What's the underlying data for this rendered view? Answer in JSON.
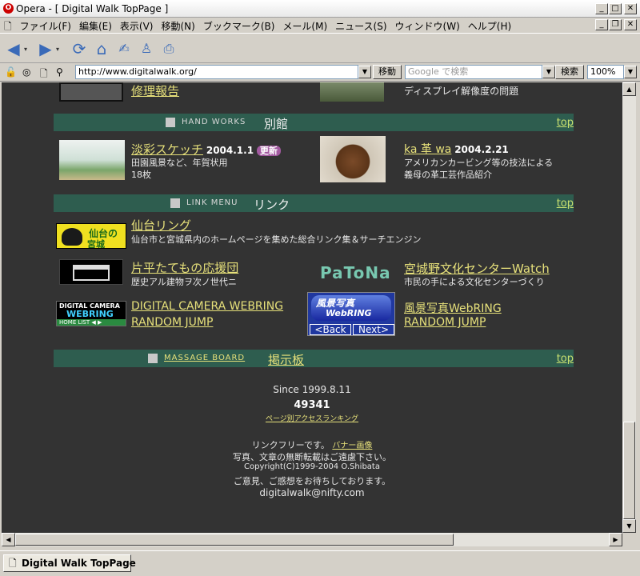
{
  "window": {
    "title": "Opera - [ Digital Walk TopPage ]"
  },
  "menu": [
    "ファイル(F)",
    "編集(E)",
    "表示(V)",
    "移動(N)",
    "ブックマーク(B)",
    "メール(M)",
    "ニュース(S)",
    "ウィンドウ(W)",
    "ヘルプ(H)"
  ],
  "address": {
    "url": "http://www.digitalwalk.org/",
    "go_label": "移動",
    "search_placeholder": "Google で検索",
    "search_label": "検索",
    "zoom": "100%"
  },
  "content": {
    "top_row": {
      "left_link": "修理報告",
      "right_desc": "ディスプレイ解像度の問題"
    },
    "handworks": {
      "en": "HAND WORKS",
      "jp": "別館",
      "top": "top",
      "items": [
        {
          "title": "淡彩スケッチ",
          "date": "2004.1.1",
          "badge": "更新",
          "desc1": "田園風景など、年賀状用",
          "desc2": "18枚"
        },
        {
          "title": "ka 革 wa",
          "date": "2004.2.21",
          "desc1": "アメリカンカービング等の技法による",
          "desc2": "義母の革工芸作品紹介"
        }
      ]
    },
    "linkmenu": {
      "en": "LINK MENU",
      "jp": "リンク",
      "top": "top",
      "sendai": {
        "title": "仙台リング",
        "desc": "仙台市と宮城県内のホームページを集めた総合リンク集＆サーチエンジン",
        "logo_line1": "仙台の",
        "logo_line2": "宮城"
      },
      "tatemono": {
        "title": "片平たてもの応援団",
        "desc": "歴史アル建物ヲ次ノ世代ニ"
      },
      "patona": {
        "logo": "PaToNa",
        "title": "宮城野文化センターWatch",
        "desc": "市民の手による文化センターづくり"
      },
      "dcw": {
        "logo_line1": "DIGITAL CAMERA",
        "logo_line2": "WEBRING",
        "logo_line3": "HOME LIST ◀ ▶",
        "title": "DIGITAL CAMERA WEBRING",
        "random": "RANDOM JUMP"
      },
      "fukei": {
        "logo_line1": "風景写真",
        "logo_line2": "WebRING",
        "back": "<Back",
        "next": "Next>",
        "title": "風景写真WebRING",
        "random": "RANDOM JUMP"
      }
    },
    "board": {
      "en": "MASSAGE BOARD",
      "jp": "掲示板",
      "top": "top"
    },
    "footer": {
      "since": "Since 1999.8.11",
      "counter": "49341",
      "ranking": "ページ別アクセスランキング",
      "linkfree": "リンクフリーです。",
      "banner": "バナー画像",
      "noreprint": "写真、文章の無断転載はご遠慮下さい。",
      "copyright": "Copyright(C)1999-2004 O.Shibata",
      "feedback": "ご意見、ご感想をお待ちしております。",
      "email": "digitalwalk@nifty.com"
    }
  },
  "status": {
    "tab_label": "Digital Walk TopPage"
  },
  "colors": {
    "page_bg": "#333333",
    "section_bar": "#2e5d4f",
    "link": "#e6e07a"
  }
}
